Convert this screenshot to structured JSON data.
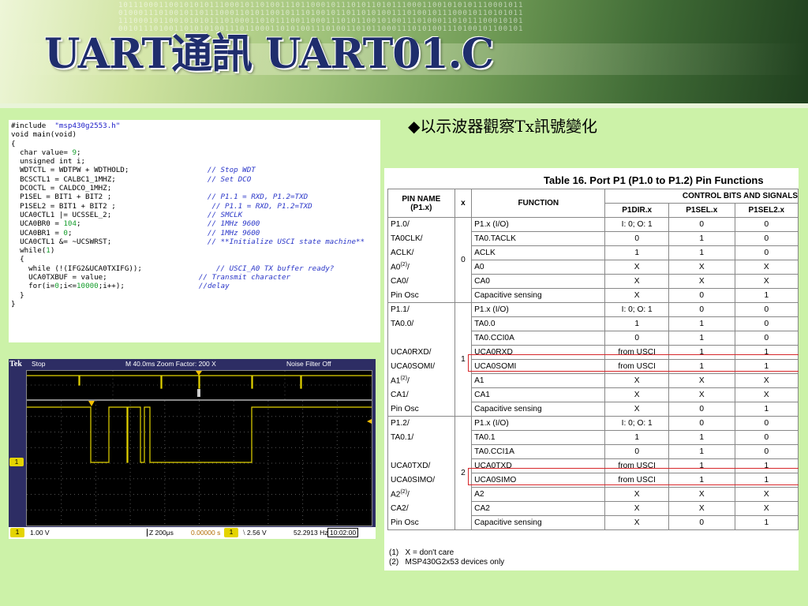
{
  "slide": {
    "title": "UART通訊 UART01.C",
    "bullet_symbol": "◆",
    "bullet_text": "以示波器觀察Tx訊號變化"
  },
  "code": {
    "lines": [
      [
        {
          "t": "#include  ",
          "c": "k"
        },
        {
          "t": "\"msp430g2553.h\"",
          "c": "s"
        }
      ],
      [
        {
          "t": "void main(void)",
          "c": "k"
        }
      ],
      [
        {
          "t": "{",
          "c": "k"
        }
      ],
      [
        {
          "t": "  char value= ",
          "c": "k"
        },
        {
          "t": "9",
          "c": "n"
        },
        {
          "t": ";",
          "c": "k"
        }
      ],
      [
        {
          "t": "  unsigned int i;",
          "c": "k"
        }
      ],
      [
        {
          "t": "  WDTCTL = WDTPW + WDTHOLD;                  ",
          "c": "k"
        },
        {
          "t": "// Stop WDT",
          "c": "c"
        }
      ],
      [
        {
          "t": "  BCSCTL1 = CALBC1_1MHZ;                     ",
          "c": "k"
        },
        {
          "t": "// Set DCO",
          "c": "c"
        }
      ],
      [
        {
          "t": "  DCOCTL = CALDCO_1MHZ;",
          "c": "k"
        }
      ],
      [
        {
          "t": "  P1SEL = BIT1 + BIT2 ;                      ",
          "c": "k"
        },
        {
          "t": "// P1.1 = RXD, P1.2=TXD",
          "c": "c"
        }
      ],
      [
        {
          "t": "  P1SEL2 = BIT1 + BIT2 ;                      ",
          "c": "k"
        },
        {
          "t": "// P1.1 = RXD, P1.2=TXD",
          "c": "c"
        }
      ],
      [
        {
          "t": "  UCA0CTL1 |= UCSSEL_2;                      ",
          "c": "k"
        },
        {
          "t": "// SMCLK",
          "c": "c"
        }
      ],
      [
        {
          "t": "  UCA0BR0 = ",
          "c": "k"
        },
        {
          "t": "104",
          "c": "n"
        },
        {
          "t": ";                             ",
          "c": "k"
        },
        {
          "t": "// 1MHz 9600",
          "c": "c"
        }
      ],
      [
        {
          "t": "  UCA0BR1 = ",
          "c": "k"
        },
        {
          "t": "0",
          "c": "n"
        },
        {
          "t": ";                               ",
          "c": "k"
        },
        {
          "t": "// 1MHz 9600",
          "c": "c"
        }
      ],
      [
        {
          "t": "  UCA0CTL1 &= ~UCSWRST;                      ",
          "c": "k"
        },
        {
          "t": "// **Initialize USCI state machine**",
          "c": "c"
        }
      ],
      [
        {
          "t": "  while(",
          "c": "k"
        },
        {
          "t": "1",
          "c": "n"
        },
        {
          "t": ")",
          "c": "k"
        }
      ],
      [
        {
          "t": "  {",
          "c": "k"
        }
      ],
      [
        {
          "t": "    while (!(IFG2&UCA0TXIFG));                 ",
          "c": "k"
        },
        {
          "t": "// USCI_A0 TX buffer ready?",
          "c": "c"
        }
      ],
      [
        {
          "t": "    UCA0TXBUF = value;                     ",
          "c": "k"
        },
        {
          "t": "// Transmit character",
          "c": "c"
        }
      ],
      [
        {
          "t": "    for(i=",
          "c": "k"
        },
        {
          "t": "0",
          "c": "n"
        },
        {
          "t": ";i<=",
          "c": "k"
        },
        {
          "t": "10000",
          "c": "n"
        },
        {
          "t": ";i++);                 ",
          "c": "k"
        },
        {
          "t": "//delay",
          "c": "c"
        }
      ],
      [
        {
          "t": "  }",
          "c": "k"
        }
      ],
      [
        {
          "t": "}",
          "c": "k"
        }
      ]
    ]
  },
  "scope": {
    "brand": "Tek",
    "state": "Stop",
    "timebase": "M 40.0ms  Zoom Factor: 200 X",
    "noise_filter": "Noise Filter Off",
    "ch1_marker": "1",
    "ch1_scale": "1.00 V",
    "zoom_time": "Z 200μs",
    "position": "0.00000 s",
    "trigger_ch": "1",
    "trigger_level": "⧵ 2.56 V",
    "frequency": "52.2913 Hz",
    "clock": "10:02:00",
    "colors": {
      "trace": "#e4d400",
      "marker": "#f5c000",
      "bg": "#2d2d64"
    }
  },
  "table": {
    "title": "Table 16. Port P1 (P1.0 to P1.2) Pin Functions",
    "headers": {
      "pin_name": "PIN NAME\n(P1.x)",
      "x": "x",
      "function": "FUNCTION",
      "control_group": "CONTROL BITS AND SIGNALS",
      "p1dir": "P1DIR.x",
      "p1sel": "P1SEL.x",
      "p1sel2": "P1SEL2.x"
    },
    "groups": [
      {
        "x": "0",
        "pins": [
          "P1.0/",
          "TA0CLK/",
          "ACLK/",
          "A0(2)/",
          "CA0/",
          "Pin Osc"
        ],
        "rows": [
          [
            "P1.x (I/O)",
            "I: 0; O: 1",
            "0",
            "0"
          ],
          [
            "TA0.TACLK",
            "0",
            "1",
            "0"
          ],
          [
            "ACLK",
            "1",
            "1",
            "0"
          ],
          [
            "A0",
            "X",
            "X",
            "X"
          ],
          [
            "CA0",
            "X",
            "X",
            "X"
          ],
          [
            "Capacitive sensing",
            "X",
            "0",
            "1"
          ]
        ]
      },
      {
        "x": "1",
        "pins": [
          "P1.1/",
          "TA0.0/",
          "",
          "UCA0RXD/",
          "UCA0SOMI/",
          "A1(2)/",
          "CA1/",
          "Pin Osc"
        ],
        "rows": [
          [
            "P1.x (I/O)",
            "I: 0; O: 1",
            "0",
            "0"
          ],
          [
            "TA0.0",
            "1",
            "1",
            "0"
          ],
          [
            "TA0.CCI0A",
            "0",
            "1",
            "0"
          ],
          [
            "UCA0RXD",
            "from USCI",
            "1",
            "1"
          ],
          [
            "UCA0SOMI",
            "from USCI",
            "1",
            "1"
          ],
          [
            "A1",
            "X",
            "X",
            "X"
          ],
          [
            "CA1",
            "X",
            "X",
            "X"
          ],
          [
            "Capacitive sensing",
            "X",
            "0",
            "1"
          ]
        ]
      },
      {
        "x": "2",
        "pins": [
          "P1.2/",
          "TA0.1/",
          "",
          "UCA0TXD/",
          "UCA0SIMO/",
          "A2(2)/",
          "CA2/",
          "Pin Osc"
        ],
        "rows": [
          [
            "P1.x (I/O)",
            "I: 0; O: 1",
            "0",
            "0"
          ],
          [
            "TA0.1",
            "1",
            "1",
            "0"
          ],
          [
            "TA0.CCI1A",
            "0",
            "1",
            "0"
          ],
          [
            "UCA0TXD",
            "from USCI",
            "1",
            "1"
          ],
          [
            "UCA0SIMO",
            "from USCI",
            "1",
            "1"
          ],
          [
            "A2",
            "X",
            "X",
            "X"
          ],
          [
            "CA2",
            "X",
            "X",
            "X"
          ],
          [
            "Capacitive sensing",
            "X",
            "0",
            "1"
          ]
        ]
      }
    ],
    "notes": [
      "(1)   X = don't care",
      "(2)   MSP430G2x53 devices only"
    ],
    "highlight_color": "#d7262a"
  }
}
